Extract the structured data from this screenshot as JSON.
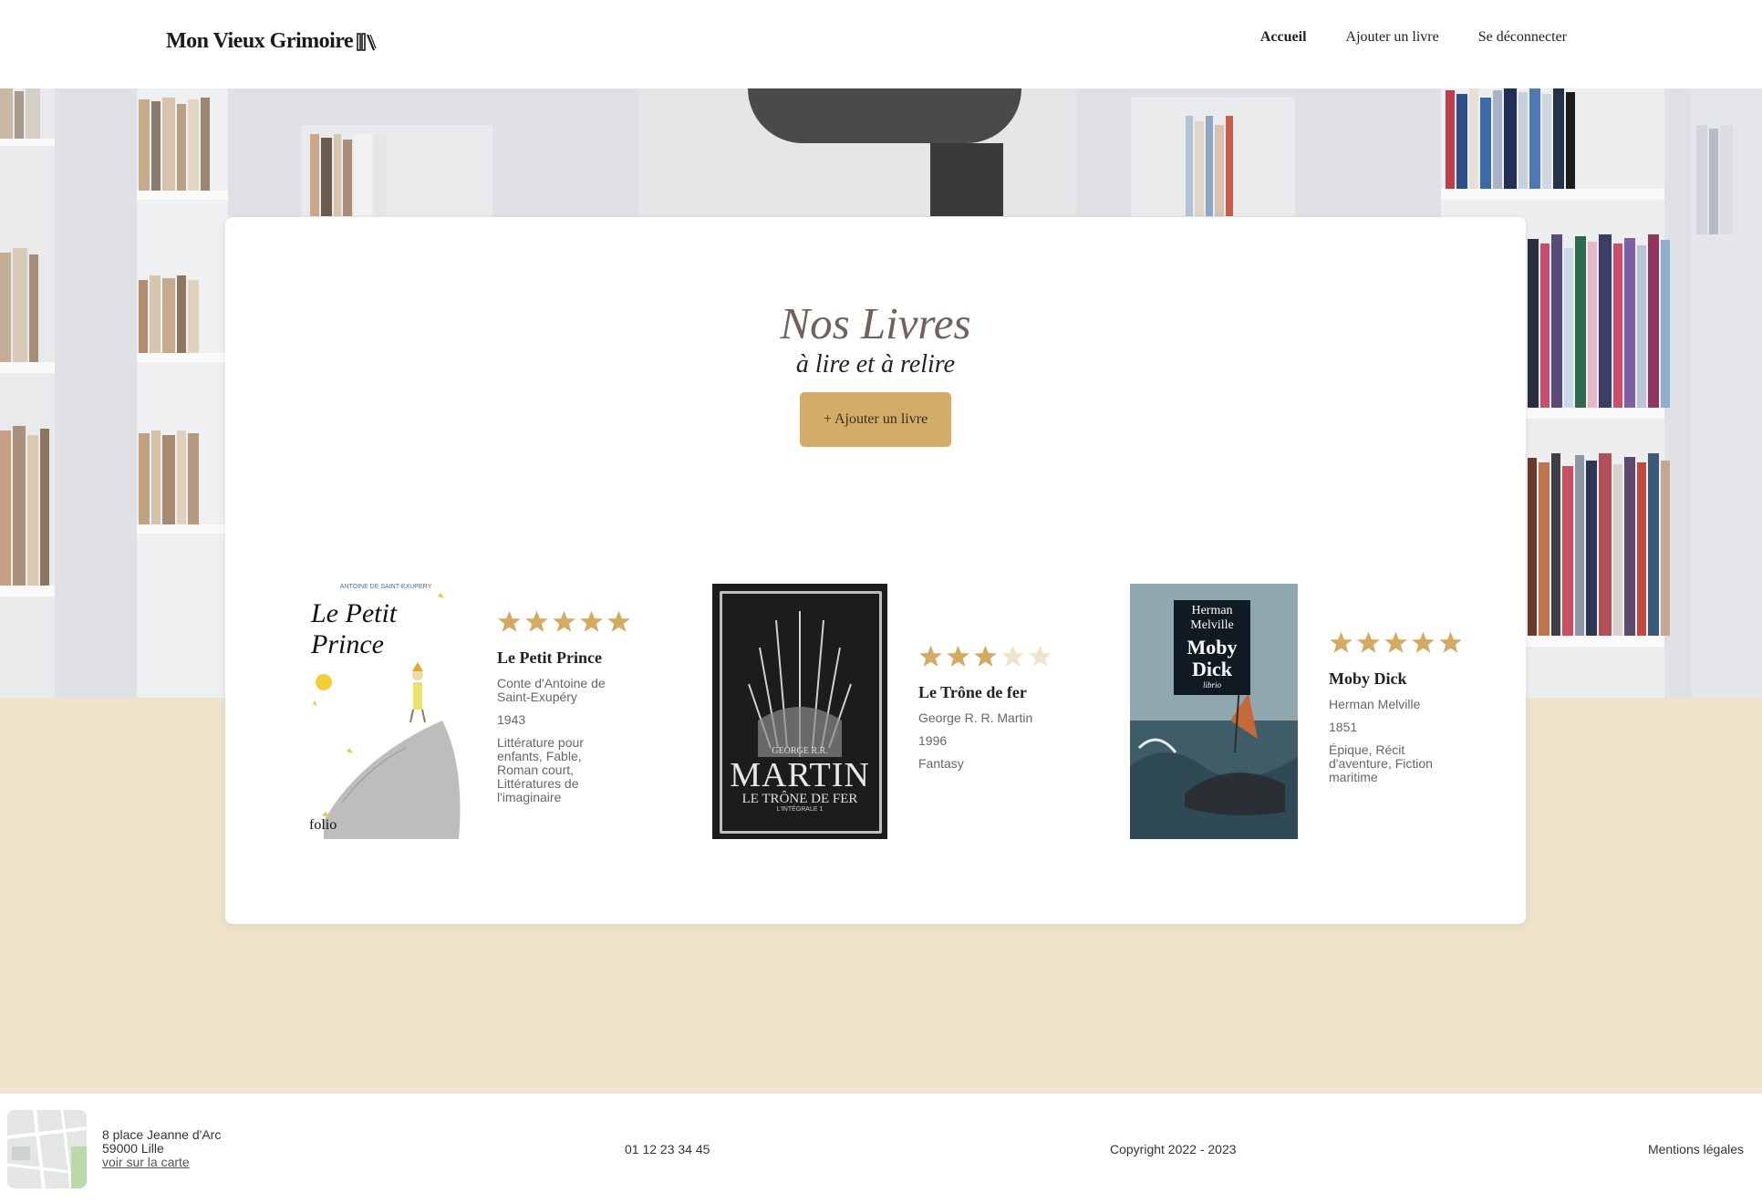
{
  "header": {
    "logo_text": "Mon Vieux Grimoire",
    "nav": [
      {
        "label": "Accueil",
        "active": true
      },
      {
        "label": "Ajouter un livre",
        "active": false
      },
      {
        "label": "Se déconnecter",
        "active": false
      }
    ]
  },
  "main": {
    "title": "Nos Livres",
    "subtitle": "à lire et à relire",
    "add_button_label": "+ Ajouter un livre",
    "books": [
      {
        "title": "Le Petit Prince",
        "author": "Conte d'Antoine de Saint-Exupéry",
        "year": "1943",
        "genres": "Littérature pour enfants, Fable, Roman court, Littératures de l'imaginaire",
        "rating": 5,
        "cover": {
          "top_text": "ANTOINE DE SAINT-EXUPÉRY",
          "title": "Le Petit Prince",
          "publisher": "folio"
        }
      },
      {
        "title": "Le Trône de fer",
        "author": "George R. R. Martin",
        "year": "1996",
        "genres": "Fantasy",
        "rating": 3,
        "cover": {
          "author_small": "GEORGE R.R.",
          "author_big": "MARTIN",
          "title": "LE TRÔNE DE FER",
          "edition": "L'INTÉGRALE 1"
        }
      },
      {
        "title": "Moby Dick",
        "author": "Herman Melville",
        "year": "1851",
        "genres": "Épique, Récit d'aventure, Fiction maritime",
        "rating": 5,
        "cover": {
          "author": "Herman Melville",
          "title": "Moby Dick",
          "publisher": "librio"
        }
      }
    ]
  },
  "footer": {
    "address_line1": "8 place Jeanne d'Arc",
    "address_line2": "59000 Lille",
    "map_link": "voir sur la carte",
    "phone": "01 12 23 34 45",
    "copyright": "Copyright 2022 - 2023",
    "legal": "Mentions légales"
  },
  "colors": {
    "accent": "#d3ad68",
    "star_filled": "#d4aa63",
    "star_empty": "#f1e4cc",
    "beige": "#efe3cc"
  }
}
